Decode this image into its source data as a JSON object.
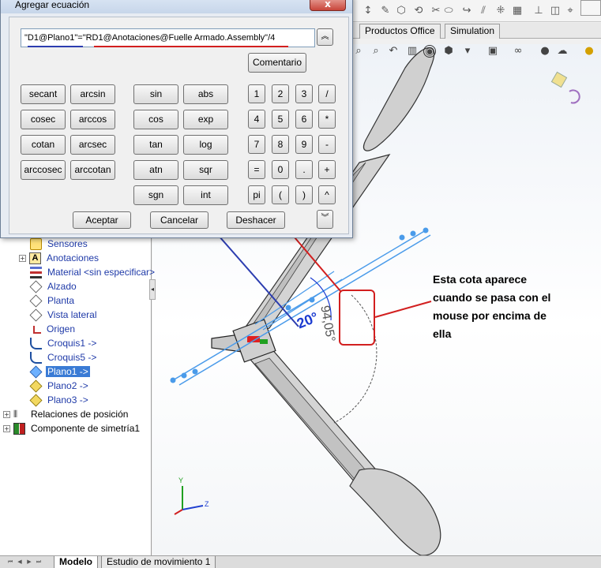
{
  "dialog": {
    "title": "Agregar ecuación",
    "close_glyph": "x",
    "equation_text": "\"D1@Plano1\"=\"RD1@Anotaciones@Fuelle Armado.Assembly\"/4",
    "comment_label": "Comentario",
    "scroll_up_glyph": "︽",
    "scroll_down_glyph": "︾",
    "function_keys": [
      "secant",
      "arcsin",
      "sin",
      "abs",
      "cosec",
      "arccos",
      "cos",
      "exp",
      "cotan",
      "arcsec",
      "tan",
      "log",
      "arccosec",
      "arccotan",
      "atn",
      "sqr",
      "sgn",
      "int"
    ],
    "numpad_keys": [
      "1",
      "2",
      "3",
      "/",
      "4",
      "5",
      "6",
      "*",
      "7",
      "8",
      "9",
      "-",
      "=",
      "0",
      ".",
      "+",
      "pi",
      "(",
      ")",
      "^"
    ],
    "accept_label": "Aceptar",
    "cancel_label": "Cancelar",
    "undo_label": "Deshacer"
  },
  "command_manager_tabs": [
    "Productos Office",
    "Simulation"
  ],
  "feature_tree": {
    "items": [
      {
        "label": "Sensores",
        "icon": "sensor-icon",
        "color": "blue"
      },
      {
        "label": "Anotaciones",
        "icon": "annotations-icon",
        "color": "blue"
      },
      {
        "label": "Material <sin especificar>",
        "icon": "material-icon",
        "color": "blue"
      },
      {
        "label": "Alzado",
        "icon": "plane-icon",
        "color": "blue"
      },
      {
        "label": "Planta",
        "icon": "plane-icon",
        "color": "blue"
      },
      {
        "label": "Vista lateral",
        "icon": "plane-icon",
        "color": "blue"
      },
      {
        "label": "Origen",
        "icon": "origin-icon",
        "color": "blue"
      },
      {
        "label": "Croquis1 ->",
        "icon": "sketch-icon",
        "color": "blue"
      },
      {
        "label": "Croquis5 ->",
        "icon": "sketch-icon",
        "color": "blue"
      },
      {
        "label": "Plano1 ->",
        "icon": "plane-icon",
        "color": "blue",
        "selected": true
      },
      {
        "label": "Plano2 ->",
        "icon": "plane-icon",
        "color": "blue"
      },
      {
        "label": "Plano3 ->",
        "icon": "plane-icon",
        "color": "blue"
      },
      {
        "label": "Relaciones de posición",
        "icon": "mates-icon",
        "color": "black"
      },
      {
        "label": "Componente de simetría1",
        "icon": "mirror-component-icon",
        "color": "black"
      }
    ]
  },
  "viewport": {
    "dimension_angle_blue": "20°",
    "dimension_angle_gray": "94,05°",
    "triad_labels": {
      "y": "Y",
      "z": "Z"
    }
  },
  "annotation_note": [
    "Esta cota aparece",
    "cuando se pasa con el",
    "mouse por encima de",
    "ella"
  ],
  "bottom_tabs": [
    "Modelo",
    "Estudio de movimiento 1"
  ],
  "colors": {
    "annotation_red": "#d21f1f",
    "annotation_blue": "#2c3db0",
    "selection_blue": "#3a7bd5",
    "plane_blue": "#4a9bea"
  }
}
